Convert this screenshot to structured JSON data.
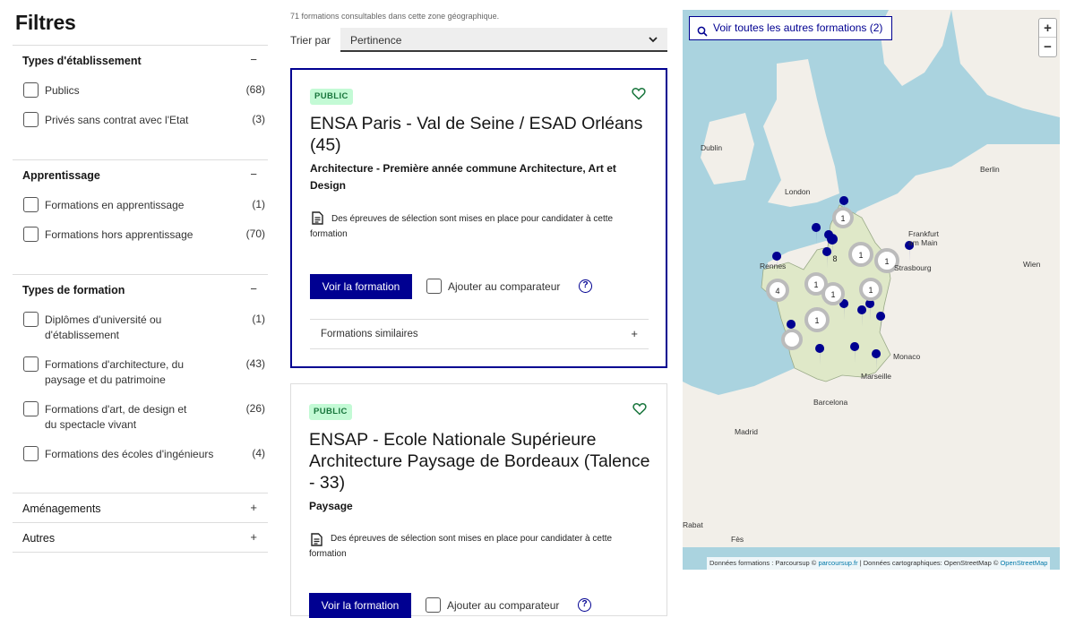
{
  "sidebar": {
    "title": "Filtres",
    "sections": [
      {
        "title": "Types d'établissement",
        "toggle": "−",
        "options": [
          {
            "label": "Publics",
            "count": "(68)"
          },
          {
            "label": "Privés sans contrat avec l'Etat",
            "count": "(3)"
          }
        ]
      },
      {
        "title": "Apprentissage",
        "toggle": "−",
        "options": [
          {
            "label": "Formations en apprentissage",
            "count": "(1)"
          },
          {
            "label": "Formations hors apprentissage",
            "count": "(70)"
          }
        ]
      },
      {
        "title": "Types de formation",
        "toggle": "−",
        "options": [
          {
            "label": "Diplômes d'université ou d'établissement",
            "count": "(1)"
          },
          {
            "label": "Formations d'architecture, du paysage et du patrimoine",
            "count": "(43)"
          },
          {
            "label": "Formations d'art, de design et du spectacle vivant",
            "count": "(26)"
          },
          {
            "label": "Formations des écoles d'ingénieurs",
            "count": "(4)"
          }
        ]
      },
      {
        "title": "Aménagements",
        "toggle": "+",
        "options": []
      },
      {
        "title": "Autres",
        "toggle": "+",
        "options": []
      }
    ]
  },
  "results": {
    "count_text": "71 formations consultables dans cette zone géographique.",
    "sort_label": "Trier par",
    "sort_value": "Pertinence"
  },
  "cards": [
    {
      "badge": "PUBLIC",
      "title": "ENSA Paris - Val de Seine / ESAD Orléans (45)",
      "subtitle": "Architecture - Première année commune Architecture, Art et Design",
      "note": "Des épreuves de sélection sont mises en place pour candidater à cette formation",
      "button": "Voir la formation",
      "compare": "Ajouter au comparateur",
      "help": "?",
      "similar": "Formations similaires",
      "similar_toggle": "+"
    },
    {
      "badge": "PUBLIC",
      "title": "ENSAP - Ecole Nationale Supérieure Architecture Paysage de Bordeaux (Talence - 33)",
      "subtitle": "Paysage",
      "note": "Des épreuves de sélection sont mises en place pour candidater à cette formation",
      "button": "Voir la formation",
      "compare": "Ajouter au comparateur",
      "help": "?"
    }
  ],
  "map": {
    "voir_button": "Voir toutes les autres formations (2)",
    "zoom_in": "+",
    "zoom_out": "−",
    "cities": [
      "Dublin",
      "London",
      "Berlin",
      "Frankfurt am Main",
      "Strasbourg",
      "Rennes",
      "Wien",
      "Monaco",
      "Marseille",
      "Barcelona",
      "Madrid",
      "Rabat",
      "Fès"
    ],
    "cluster_labels": [
      "1",
      "1",
      "4",
      "1",
      "1",
      "1",
      "1",
      "1",
      "8"
    ],
    "attribution_prefix": "Données formations : Parcoursup ©",
    "attribution_link1": "parcoursup.fr",
    "attribution_mid": "| Données cartographiques: OpenStreetMap ©",
    "attribution_link2": "OpenStreetMap",
    "colors": {
      "sea": "#aad3df",
      "land": "#f2efe9",
      "france": "#dfe8c8",
      "marker": "#000091"
    }
  }
}
